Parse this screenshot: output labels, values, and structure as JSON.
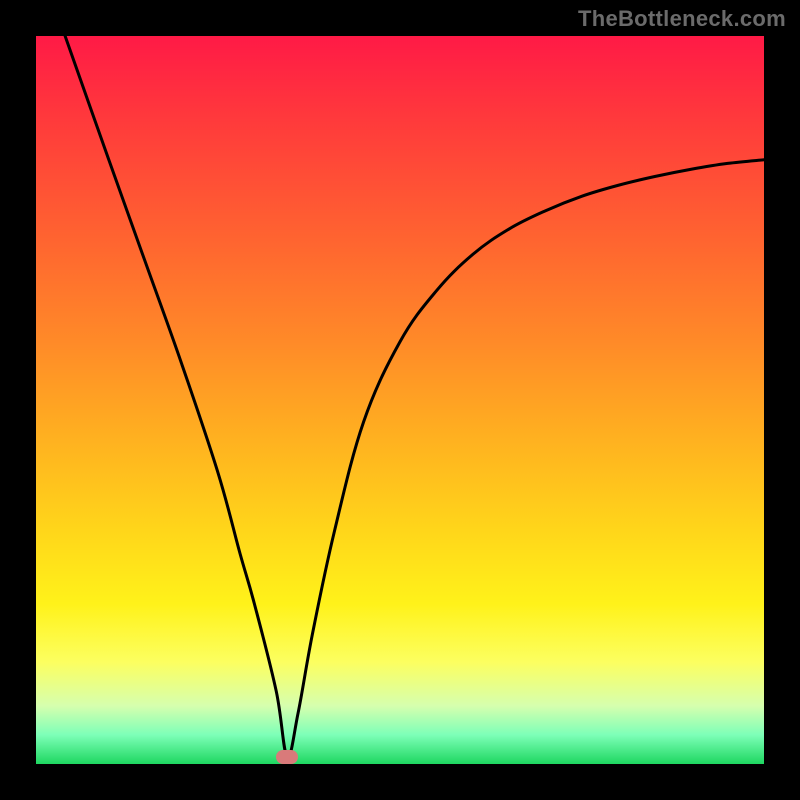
{
  "watermark": "TheBottleneck.com",
  "chart_data": {
    "type": "line",
    "title": "",
    "xlabel": "",
    "ylabel": "",
    "xlim": [
      0,
      100
    ],
    "ylim": [
      0,
      100
    ],
    "grid": false,
    "curve": {
      "x": [
        4,
        10,
        15,
        20,
        25,
        28,
        30,
        33,
        34.5,
        36,
        38,
        41,
        45,
        50,
        55,
        60,
        65,
        70,
        75,
        80,
        85,
        90,
        95,
        100
      ],
      "y": [
        100,
        83,
        69,
        55,
        40,
        29,
        22,
        10,
        1,
        7,
        18,
        32,
        47,
        58,
        65,
        70,
        73.5,
        76,
        78,
        79.5,
        80.7,
        81.7,
        82.5,
        83
      ]
    },
    "marker": {
      "x": 34.5,
      "y": 1
    },
    "gradient_stops": [
      {
        "pos": 0,
        "color": "#ff1a46"
      },
      {
        "pos": 12,
        "color": "#ff3b3b"
      },
      {
        "pos": 28,
        "color": "#ff6430"
      },
      {
        "pos": 42,
        "color": "#ff8a28"
      },
      {
        "pos": 55,
        "color": "#ffb020"
      },
      {
        "pos": 68,
        "color": "#ffd61a"
      },
      {
        "pos": 78,
        "color": "#fff21a"
      },
      {
        "pos": 86,
        "color": "#fcff60"
      },
      {
        "pos": 92,
        "color": "#d6ffae"
      },
      {
        "pos": 96,
        "color": "#7dffb8"
      },
      {
        "pos": 100,
        "color": "#1ed760"
      }
    ]
  }
}
